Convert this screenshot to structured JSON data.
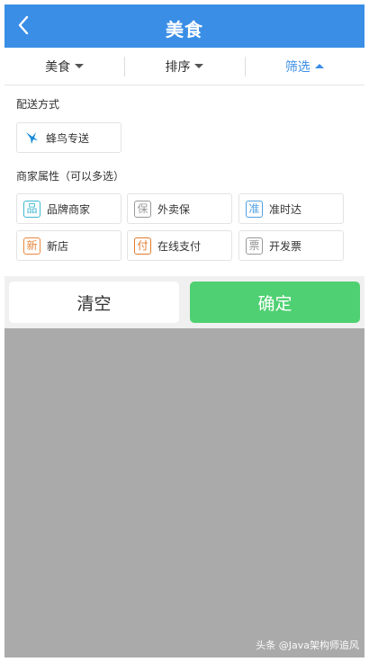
{
  "header": {
    "title": "美食",
    "back_icon": "chevron-left-icon"
  },
  "tabs": [
    {
      "label": "美食",
      "active": false
    },
    {
      "label": "排序",
      "active": false
    },
    {
      "label": "筛选",
      "active": true
    }
  ],
  "delivery": {
    "label": "配送方式",
    "option": {
      "label": "蜂鸟专送",
      "icon": "hummingbird-icon",
      "color": "#1a8bd8"
    }
  },
  "attributes": {
    "label": "商家属性（可以多选）",
    "options": [
      {
        "badge": "品",
        "label": "品牌商家",
        "color": "#3fb8d0"
      },
      {
        "badge": "保",
        "label": "外卖保",
        "color": "#999999"
      },
      {
        "badge": "准",
        "label": "准时达",
        "color": "#4f9fe0"
      },
      {
        "badge": "新",
        "label": "新店",
        "color": "#e8873e"
      },
      {
        "badge": "付",
        "label": "在线支付",
        "color": "#e07a2e"
      },
      {
        "badge": "票",
        "label": "开发票",
        "color": "#999999"
      }
    ]
  },
  "actions": {
    "clear_label": "清空",
    "confirm_label": "确定"
  },
  "watermark": "头条 @Java架构师追风",
  "colors": {
    "header": "#3a8ee6",
    "confirm": "#4fd072",
    "overlay": "#aaaaaa"
  }
}
